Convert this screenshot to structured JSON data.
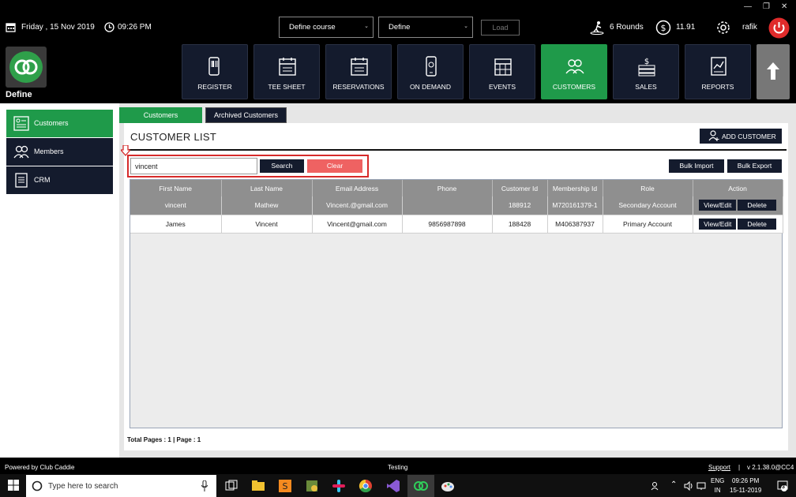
{
  "header": {
    "date": "Friday ,  15 Nov 2019",
    "time": "09:26 PM",
    "course_select": "Define  course",
    "define_select": "Define",
    "load_label": "Load",
    "rounds": "6 Rounds",
    "balance": "11.91",
    "user": "rafik",
    "brand": "Define"
  },
  "modules": [
    {
      "label": "REGISTER",
      "icon": "barcode-scanner-icon"
    },
    {
      "label": "TEE SHEET",
      "icon": "calendar-icon"
    },
    {
      "label": "RESERVATIONS",
      "icon": "calendar-icon"
    },
    {
      "label": "ON DEMAND",
      "icon": "mobile-icon"
    },
    {
      "label": "EVENTS",
      "icon": "calendar-grid-icon"
    },
    {
      "label": "CUSTOMERS",
      "icon": "users-icon"
    },
    {
      "label": "SALES",
      "icon": "money-icon"
    },
    {
      "label": "REPORTS",
      "icon": "report-icon"
    }
  ],
  "sidebar": {
    "items": [
      {
        "label": "Customers"
      },
      {
        "label": "Members"
      },
      {
        "label": "CRM"
      }
    ]
  },
  "tabs": {
    "customers": "Customers",
    "archived": "Archived Customers"
  },
  "main": {
    "title": "CUSTOMER LIST",
    "add_customer": "ADD CUSTOMER",
    "search_value": "vincent",
    "search_label": "Search",
    "clear_label": "Clear",
    "bulk_import": "Bulk Import",
    "bulk_export": "Bulk Export",
    "pages": "Total Pages : 1 | Page : 1"
  },
  "table": {
    "headers": [
      "First Name",
      "Last Name",
      "Email Address",
      "Phone",
      "Customer Id",
      "Membership Id",
      "Role",
      "Action"
    ],
    "view_label": "View/Edit",
    "delete_label": "Delete",
    "rows": [
      {
        "first": "vincent",
        "last": "Mathew",
        "email": "Vincent.@gmail.com",
        "phone": "",
        "cid": "188912",
        "mid": "M720161379-1",
        "role": "Secondary Account"
      },
      {
        "first": "James",
        "last": "Vincent",
        "email": "Vincent@gmail.com",
        "phone": "9856987898",
        "cid": "188428",
        "mid": "M406387937",
        "role": "Primary Account"
      }
    ]
  },
  "footer": {
    "powered": "Powered by Club Caddie",
    "testing": "Testing",
    "support": "Support",
    "separator": "|",
    "version": "v 2.1.38.0@CC4"
  },
  "taskbar": {
    "search_placeholder": "Type here to search",
    "lang1": "ENG",
    "lang2": "IN",
    "time": "09:26 PM",
    "date": "15-11-2019",
    "notifications": "3"
  },
  "colors": {
    "accent_green": "#1f9a4a",
    "navy": "#141b2d",
    "clear_red": "#ef6262",
    "power_red": "#e02b2b"
  }
}
